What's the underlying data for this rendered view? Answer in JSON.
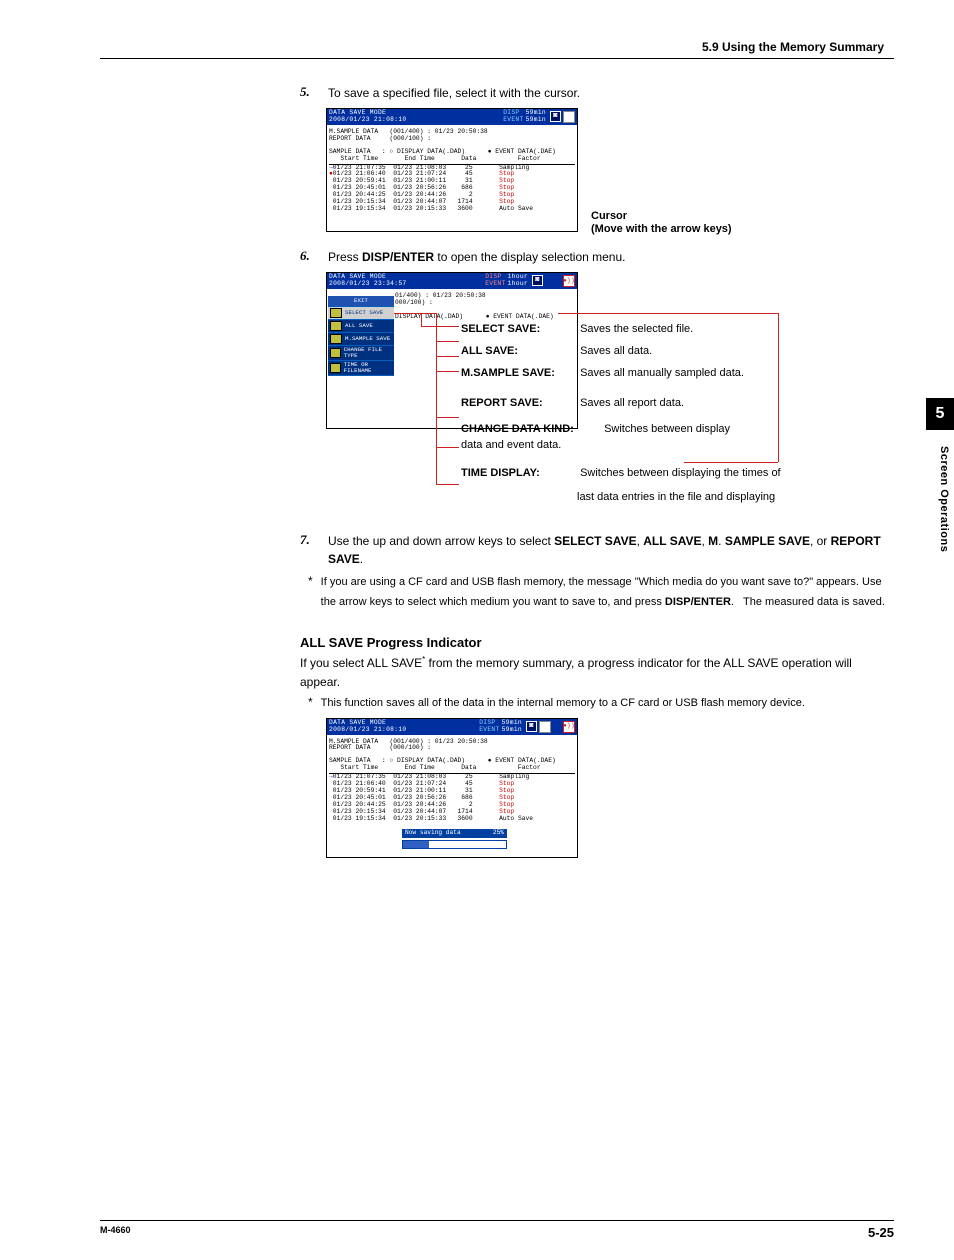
{
  "header": {
    "section_title": "5.9  Using the Memory Summary"
  },
  "steps": {
    "s5": {
      "num": "5.",
      "text_a": "To save a specified file, select it with the cursor."
    },
    "s6": {
      "num": "6.",
      "text_a": "Press ",
      "text_b": "DISP/ENTER",
      "text_c": " to open the display selection menu."
    },
    "s7": {
      "num": "7.",
      "text_a": "Use the up and down arrow keys to select ",
      "b1": "SELECT SAVE",
      "comma1": ", ",
      "b2": "ALL SAVE",
      "comma2": ", ",
      "b3": "M",
      "dot": ". ",
      "b4": "SAMPLE SAVE",
      "comma3": ", or ",
      "b5": "REPORT SAVE",
      "dot2": "."
    }
  },
  "side_label": {
    "l1": "Cursor",
    "l2": "(Move with the arrow keys)"
  },
  "callouts": {
    "select_save": {
      "label": "SELECT SAVE:",
      "desc": "Saves the selected file."
    },
    "all_save": {
      "label": "ALL SAVE:",
      "desc": "Saves all data."
    },
    "msample_save": {
      "label": "M.SAMPLE SAVE:",
      "desc": "Saves all manually sampled data."
    },
    "report_save": {
      "label": "REPORT SAVE:",
      "desc": "Saves all report data."
    },
    "change_kind": {
      "label": "CHANGE DATA KIND:",
      "desc1": "Switches between display",
      "desc2": "data and event data."
    },
    "time_display": {
      "label": "TIME DISPLAY:",
      "desc1": "Switches between displaying the times of",
      "desc2": "last data entries in the file and displaying"
    }
  },
  "star1": {
    "text_a": "If you are using a CF card and USB flash memory, the message \"Which media do you want save to?\" appears. Use the arrow keys to select which medium you want to save to, and press ",
    "text_b": "DISP/ENTER",
    "text_c": ".",
    "after": "The measured data is saved."
  },
  "subsection": {
    "title": "ALL SAVE Progress Indicator",
    "para_a": "If you select ALL SAVE",
    "para_sup": "*",
    "para_b": " from the memory summary, a progress indicator for the ALL SAVE operation will appear."
  },
  "star2": {
    "text": "This function saves all of the data in the internal memory to a CF card or USB flash memory device."
  },
  "figure1": {
    "titlebar_l1": "DATA SAVE MODE",
    "titlebar_l2": "2008/01/23 21:08:10",
    "disp": "DISP",
    "event": "EVENT",
    "time_a": "59min",
    "time_b": "59min",
    "sub_a": "M.SAMPLE DATA   (001/400) : 01/23 20:50:38",
    "sub_b": "REPORT DATA     (000/100) :",
    "legend_a": "SAMPLE DATA",
    "legend_o": "○ DISPLAY DATA(.DAD)",
    "legend_e": "● EVENT DATA(.DAE)",
    "hdr": "   Start Time       End Time       Data           Factor",
    "rows": [
      {
        "arrow": "→",
        "start": "01/23 21:07:35",
        "end": "01/23 21:08:03",
        "data": "   25",
        "factor": "Sampling",
        "red": false,
        "arrow_blue": true
      },
      {
        "arrow": "●",
        "start": "01/23 21:06:40",
        "end": "01/23 21:07:24",
        "data": "   45",
        "factor": "Stop",
        "red": true,
        "arrow_red": true
      },
      {
        "arrow": " ",
        "start": "01/23 20:59:41",
        "end": "01/23 21:00:11",
        "data": "   31",
        "factor": "Stop",
        "red": true
      },
      {
        "arrow": " ",
        "start": "01/23 20:45:01",
        "end": "01/23 20:56:26",
        "data": "  686",
        "factor": "Stop",
        "red": true
      },
      {
        "arrow": " ",
        "start": "01/23 20:44:25",
        "end": "01/23 20:44:26",
        "data": "    2",
        "factor": "Stop",
        "red": true
      },
      {
        "arrow": " ",
        "start": "01/23 20:15:34",
        "end": "01/23 20:44:07",
        "data": " 1714",
        "factor": "Stop",
        "red": true
      },
      {
        "arrow": " ",
        "start": "01/23 19:15:34",
        "end": "01/23 20:15:33",
        "data": " 3600",
        "factor": "Auto Save",
        "red": false
      }
    ]
  },
  "figure2": {
    "titlebar_l1": "DATA SAVE MODE",
    "titlebar_l2": "2008/01/23 23:34:57",
    "disp": "DISP",
    "event": "EVENT",
    "time_a": "1hour",
    "time_b": "1hour",
    "menu": {
      "exit": "EXIT",
      "items": [
        "SELECT SAVE",
        "ALL SAVE",
        "M.SAMPLE SAVE",
        "CHANGE FILE TYPE",
        "TIME OR FILENAME"
      ]
    },
    "sub_a": "01/400) : 01/23 20:50:38",
    "sub_b": "000/100) :",
    "legend": "DISPLAY DATA(.DAD)      ● EVENT DATA(.DAE)"
  },
  "figure3": {
    "titlebar_l1": "DATA SAVE MODE",
    "titlebar_l2": "2008/01/23 21:08:10",
    "disp": "DISP",
    "event": "EVENT",
    "time_a": "59min",
    "time_b": "59min",
    "sub_a": "M.SAMPLE DATA   (001/400) : 01/23 20:50:38",
    "sub_b": "REPORT DATA     (000/100) :",
    "legend_a": "SAMPLE DATA",
    "legend_o": "○ DISPLAY DATA(.DAD)",
    "legend_e": "● EVENT DATA(.DAE)",
    "hdr": "   Start Time       End Time       Data           Factor",
    "saving_label": "Now saving data",
    "saving_pct": "25%"
  },
  "chapter": {
    "num": "5",
    "side": "Screen Operations"
  },
  "footer": {
    "left": "M-4660",
    "right": "5-25"
  }
}
